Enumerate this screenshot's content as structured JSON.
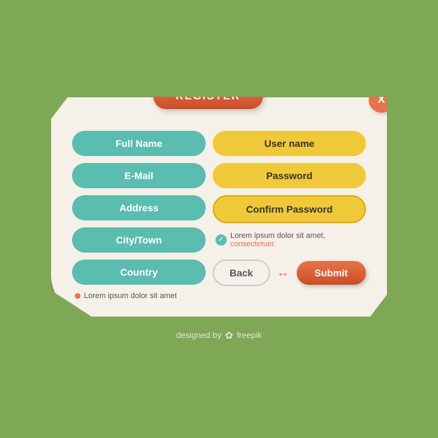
{
  "header": {
    "register_label": "REGISTER",
    "close_label": "X"
  },
  "form": {
    "left_fields": [
      {
        "label": "Full Name"
      },
      {
        "label": "E-Mail"
      },
      {
        "label": "Address"
      },
      {
        "label": "City/Town"
      },
      {
        "label": "Country"
      }
    ],
    "right_fields": [
      {
        "label": "User name"
      },
      {
        "label": "Password"
      },
      {
        "label": "Confirm Password"
      }
    ],
    "validation_text": "Lorem ipsum dolor sit amet,",
    "validation_link": "consectetuer.",
    "back_label": "Back",
    "submit_label": "Submit",
    "error_text": "Lorem ipsum dolor sit amet"
  },
  "footer": {
    "text": "designed by",
    "brand": "freepik"
  }
}
